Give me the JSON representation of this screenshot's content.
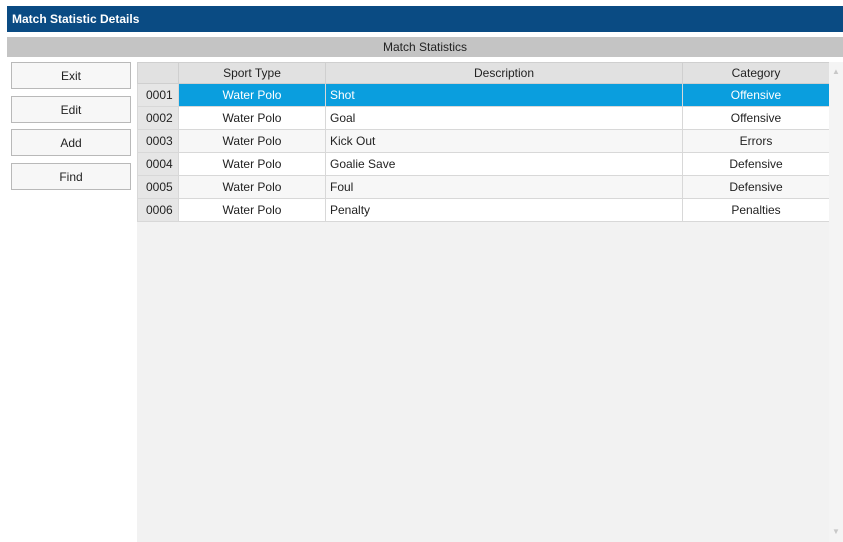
{
  "window": {
    "title": "Match Statistic Details"
  },
  "section": {
    "header": "Match Statistics"
  },
  "actions": {
    "exit": "Exit",
    "edit": "Edit",
    "add": "Add",
    "find": "Find"
  },
  "grid": {
    "columns": {
      "num": "",
      "sport": "Sport Type",
      "description": "Description",
      "category": "Category"
    },
    "rows": [
      {
        "num": "0001",
        "sport": "Water Polo",
        "description": "Shot",
        "category": "Offensive"
      },
      {
        "num": "0002",
        "sport": "Water Polo",
        "description": "Goal",
        "category": "Offensive"
      },
      {
        "num": "0003",
        "sport": "Water Polo",
        "description": "Kick Out",
        "category": "Errors"
      },
      {
        "num": "0004",
        "sport": "Water Polo",
        "description": "Goalie Save",
        "category": "Defensive"
      },
      {
        "num": "0005",
        "sport": "Water Polo",
        "description": "Foul",
        "category": "Defensive"
      },
      {
        "num": "0006",
        "sport": "Water Polo",
        "description": "Penalty",
        "category": "Penalties"
      }
    ],
    "selected_row": 0
  },
  "icons": {
    "scroll_up": "chevron-up-icon",
    "scroll_down": "chevron-down-icon"
  },
  "colors": {
    "title_bar": "#0a4b83",
    "selection": "#0a9ede",
    "section_header": "#c4c4c4"
  }
}
